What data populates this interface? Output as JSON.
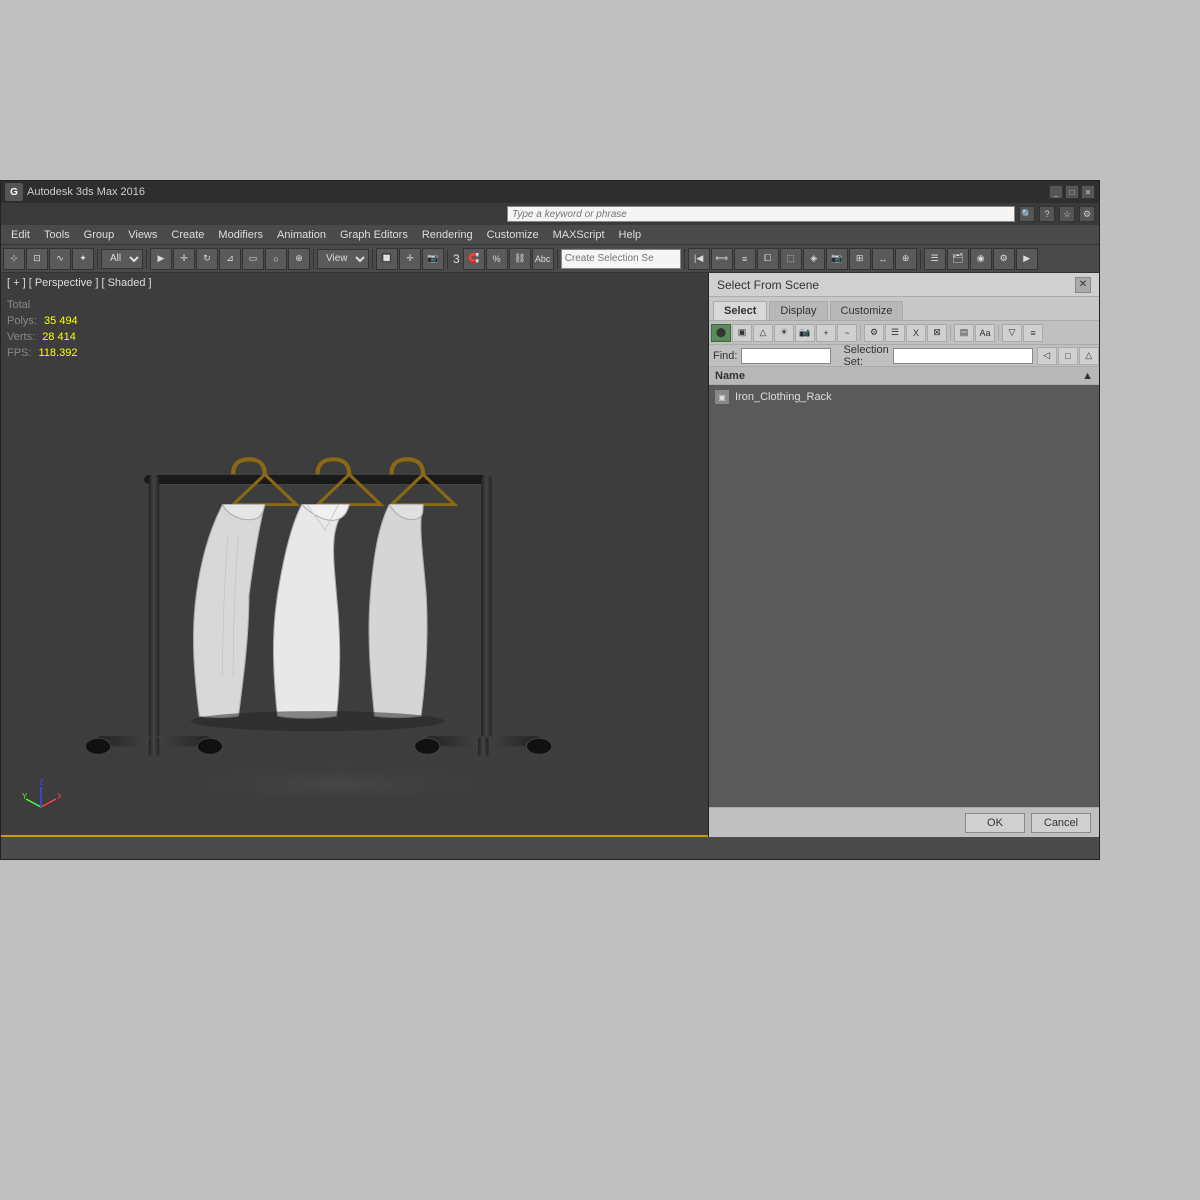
{
  "app": {
    "title": "Autodesk 3ds Max 2016",
    "logo": "G"
  },
  "search": {
    "placeholder": "Type a keyword or phrase"
  },
  "menu": {
    "items": [
      "Edit",
      "Tools",
      "Group",
      "Views",
      "Create",
      "Modifiers",
      "Animation",
      "Graph Editors",
      "Rendering",
      "Customize",
      "MAXScript",
      "Help"
    ]
  },
  "toolbar": {
    "filter_dropdown": "All",
    "view_dropdown": "View",
    "create_selection": "Create Selection Se"
  },
  "viewport": {
    "label": "[ + ] [ Perspective ] [ Shaded ]",
    "stats": {
      "total_label": "Total",
      "polys_label": "Polys:",
      "polys_value": "35 494",
      "verts_label": "Verts:",
      "verts_value": "28 414",
      "fps_label": "FPS:",
      "fps_value": "118.392"
    }
  },
  "select_panel": {
    "title": "Select From Scene",
    "tabs": [
      "Select",
      "Display",
      "Customize"
    ],
    "active_tab": "Select",
    "find_label": "Find:",
    "find_value": "",
    "selection_set_label": "Selection Set:",
    "selection_set_value": "",
    "name_column": "Name",
    "objects": [
      {
        "name": "Iron_Clothing_Rack",
        "icon": "▣",
        "selected": false
      }
    ],
    "ok_label": "OK",
    "cancel_label": "Cancel"
  }
}
